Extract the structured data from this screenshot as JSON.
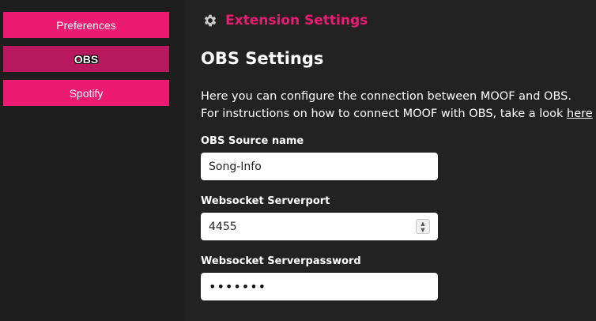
{
  "sidebar": {
    "items": [
      {
        "label": "Preferences"
      },
      {
        "label": "OBS"
      },
      {
        "label": "Spotify"
      }
    ]
  },
  "header": {
    "icon": "gear-icon",
    "title": "Extension Settings"
  },
  "main": {
    "title": "OBS Settings",
    "description_line1": "Here you can configure the connection between MOOF and OBS.",
    "description_line2": "For instructions on how to connect MOOF with OBS, take a look ",
    "link_text": "here",
    "fields": [
      {
        "label": "OBS Source name",
        "value": "Song-Info"
      },
      {
        "label": "Websocket Serverport",
        "value": "4455"
      },
      {
        "label": "Websocket Serverpassword",
        "value": "•••••••"
      }
    ]
  },
  "colors": {
    "accent": "#ed1a72",
    "accent_active": "#b8185e",
    "background": "#222222",
    "sidebar": "#1e1e1e"
  }
}
